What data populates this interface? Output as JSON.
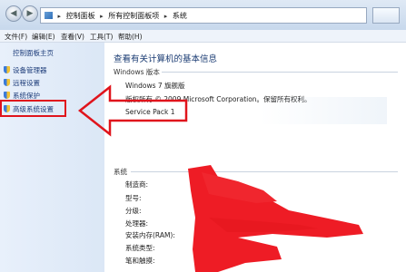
{
  "address_bar": {
    "breadcrumbs": [
      "控制面板",
      "所有控制面板项",
      "系统"
    ]
  },
  "menu": [
    "文件(F)",
    "编辑(E)",
    "查看(V)",
    "工具(T)",
    "帮助(H)"
  ],
  "left_pane": {
    "home_link": "控制面板主页",
    "links": [
      "设备管理器",
      "远程设置",
      "系统保护",
      "高级系统设置"
    ]
  },
  "main": {
    "title": "查看有关计算机的基本信息",
    "edition_header": "Windows 版本",
    "edition_lines": [
      "Windows 7 旗舰版",
      "版权所有 © 2009 Microsoft Corporation。保留所有权利。",
      "Service Pack 1"
    ],
    "system_header": "系统",
    "system_fields": [
      "制造商:",
      "型号:",
      "分级:",
      "处理器:",
      "安装内存(RAM):",
      "系统类型:",
      "笔和触摸:"
    ]
  },
  "colors": {
    "annotation_red": "#e0141c",
    "link_blue": "#1e3d7a",
    "title_blue": "#1b3c73"
  }
}
